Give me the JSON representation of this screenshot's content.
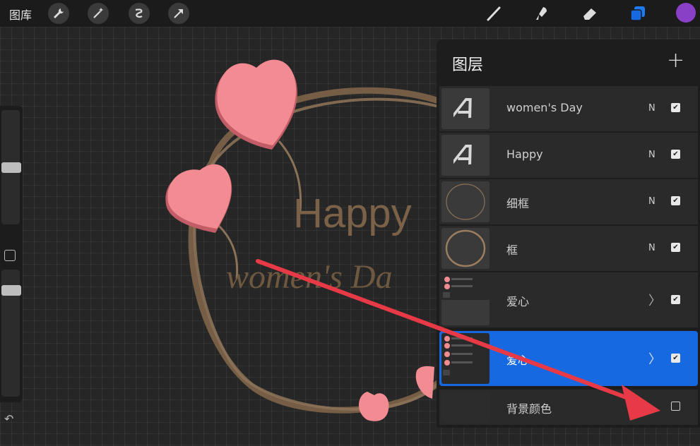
{
  "topbar": {
    "gallery_label": "图库",
    "tools": [
      "wrench-icon",
      "magic-wand-icon",
      "selection-icon",
      "transform-arrow-icon"
    ],
    "right_tools": [
      "brush-icon",
      "smudge-icon",
      "eraser-icon",
      "layers-icon"
    ],
    "current_color": "#8a3fc7"
  },
  "canvas_text": {
    "happy": "Happy",
    "womens_day": "women's Da"
  },
  "layers_panel": {
    "title": "图层",
    "add_label": "+",
    "layers": [
      {
        "name": "women's Day",
        "blend": "N",
        "visible": true,
        "type": "text"
      },
      {
        "name": "Happy",
        "blend": "N",
        "visible": true,
        "type": "text"
      },
      {
        "name": "细框",
        "blend": "N",
        "visible": true,
        "type": "image"
      },
      {
        "name": "框",
        "blend": "N",
        "visible": true,
        "type": "image"
      },
      {
        "name": "爱心",
        "blend": "",
        "visible": true,
        "type": "group"
      },
      {
        "name": "爱心",
        "blend": "",
        "visible": true,
        "type": "group",
        "selected": true
      },
      {
        "name": "背景颜色",
        "blend": "",
        "visible": false,
        "type": "background"
      }
    ]
  },
  "colors": {
    "accent": "#1669e0",
    "heart": "#f28b92",
    "frame": "#7a6148",
    "arrow": "#e83a46"
  }
}
